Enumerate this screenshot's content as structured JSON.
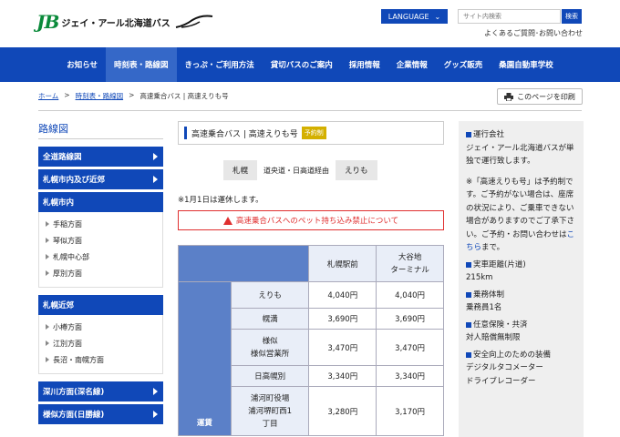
{
  "header": {
    "logo_mark": "JB",
    "logo_text": "ジェイ・アール北海道バス",
    "language_label": "LANGUAGE",
    "search_placeholder": "サイト内検索",
    "search_button": "検索",
    "util_links": "よくあるご質問･お問い合わせ"
  },
  "nav": {
    "items": [
      "お知らせ",
      "時刻表・路線図",
      "きっぷ・ご利用方法",
      "貸切バスのご案内",
      "採用情報",
      "企業情報",
      "グッズ販売",
      "桑園自動車学校"
    ]
  },
  "breadcrumb": {
    "home": "ホーム",
    "sep": ">",
    "timetable": "時刻表・路線図",
    "current": "高速乗合バス | 高速えりも号"
  },
  "print_label": "このページを印刷",
  "sidebar": {
    "title": "路線図",
    "top_items": [
      "全道路線図",
      "札幌市内及び近郊"
    ],
    "group1": {
      "title": "札幌市内",
      "items": [
        "手稲方面",
        "琴似方面",
        "札幌中心部",
        "厚別方面"
      ]
    },
    "group2": {
      "title": "札幌近郊",
      "items": [
        "小樽方面",
        "江別方面",
        "長沼・南幌方面"
      ]
    },
    "bottom_items": [
      "深川方面(深名線)",
      "様似方面(日勝線)"
    ]
  },
  "main": {
    "route_name": "高速乗合バス | 高速えりも号",
    "badge": "予約制",
    "via_from": "札幌",
    "via_text": "道央道・日高道経由",
    "via_to": "えりも",
    "note": "※1月1日は運休します。",
    "warning": "高速乗合バスへのペット持ち込み禁止について",
    "table": {
      "col1": "札幌駅前",
      "col2": "大谷地\nターミナル",
      "side_label": "運賃",
      "rows": [
        {
          "stop": "えりも",
          "a": "4,040円",
          "b": "4,040円"
        },
        {
          "stop": "幌満",
          "a": "3,690円",
          "b": "3,690円"
        },
        {
          "stop": "様似\n様似営業所",
          "a": "3,470円",
          "b": "3,470円"
        },
        {
          "stop": "日高幌別",
          "a": "3,340円",
          "b": "3,340円"
        },
        {
          "stop": "浦河町役場\n浦河堺町西1\n丁目",
          "a": "3,280円",
          "b": "3,170円"
        }
      ]
    }
  },
  "right": {
    "operator_head": "運行会社",
    "operator_body": "ジェイ・アール北海道バスが単独で運行致します。",
    "reserve_body_1": "※「高速えりも号」は予約制です。ご予約がない場合は、座席の状況により、ご乗車できない場合がありますのでご了承下さい。ご予約・お問い合わせは",
    "reserve_link": "こちら",
    "reserve_body_2": "まで。",
    "distance_head": "実車距離(片道)",
    "distance_value": "215km",
    "crew_head": "乗務体制",
    "crew_value": "乗務員1名",
    "insurance_head": "任意保険・共済",
    "insurance_value": "対人賠償無制限",
    "safety_head": "安全向上のための装備",
    "safety_value_1": "デジタルタコメーター",
    "safety_value_2": "ドライブレコーダー"
  },
  "colors": {
    "brand_blue": "#1048b8",
    "logo_green": "#0a8a3a",
    "warning_red": "#e03030",
    "badge_gold": "#d4b000"
  }
}
